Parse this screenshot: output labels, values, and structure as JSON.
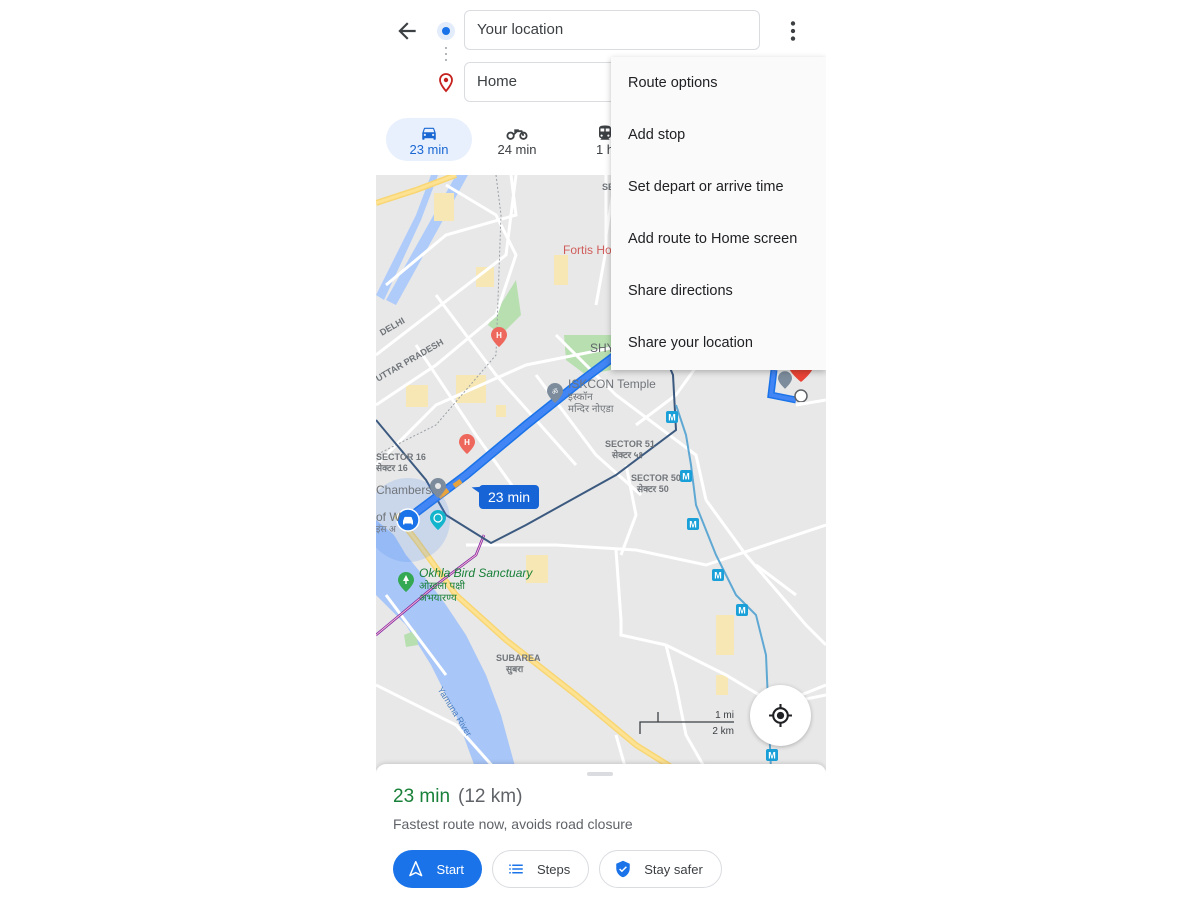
{
  "header": {
    "origin_value": "Your location",
    "destination_value": "Home",
    "back_icon": "arrow-left-icon",
    "more_icon": "more-vert-icon"
  },
  "travel_modes": [
    {
      "mode": "drive",
      "icon": "car-icon",
      "label": "23 min",
      "active": true
    },
    {
      "mode": "two-wheeler",
      "icon": "motorcycle-icon",
      "label": "24 min",
      "active": false
    },
    {
      "mode": "transit",
      "icon": "train-icon",
      "label": "1 h",
      "active": false
    }
  ],
  "menu": {
    "items": [
      "Route options",
      "Add stop",
      "Set depart or arrive time",
      "Add route to Home screen",
      "Share directions",
      "Share your location"
    ]
  },
  "map": {
    "eta_bubble": "23 min",
    "labels": {
      "fortis": "Fortis Ho",
      "shy": "SHY",
      "se_top": "SE",
      "delhi": "DELHI",
      "uttar_pradesh": "UTTAR PRADESH",
      "iskcon": "ISKCON Temple",
      "iskcon_hi1": "इस्कॉन",
      "iskcon_hi2": "मन्दिर नोएडा",
      "sector16": "SECTOR 16",
      "sector16_hi": "सेक्टर 16",
      "chambers": "Chambers",
      "wonder": "of W",
      "wonder_hi": "इंस अ",
      "sector51": "SECTOR 51",
      "sector51_hi": "सेक्टर ५१",
      "sector50": "SECTOR 50",
      "sector50_hi": "सेक्टर 50",
      "okhla": "Okhla Bird Sanctuary",
      "okhla_hi1": "ओखला पक्षी",
      "okhla_hi2": "अभयारण्य",
      "subarea": "SUBAREA",
      "subarea_hi": "सुबरा",
      "yamuna": "Yamuna River",
      "metro": "M"
    },
    "scale": {
      "imperial": "1 mi",
      "metric": "2 km"
    },
    "colors": {
      "route": "#4285f4",
      "route_dark": "#1a73e8",
      "destination_pin": "#ea4335"
    }
  },
  "summary": {
    "duration": "23 min",
    "distance": "(12 km)",
    "description": "Fastest route now, avoids road closure",
    "buttons": {
      "start": "Start",
      "steps": "Steps",
      "stay_safer": "Stay safer"
    }
  }
}
